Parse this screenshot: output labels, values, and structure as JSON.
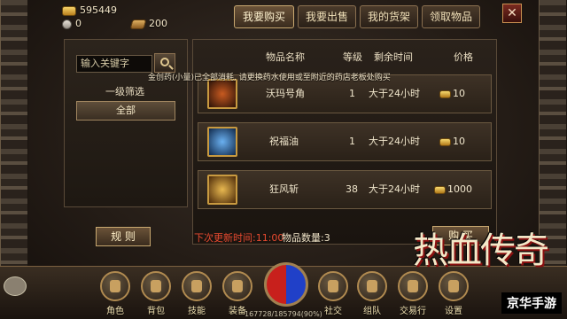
{
  "resources": {
    "gold": "595449",
    "silver": "0",
    "bars": "200"
  },
  "tabs": [
    {
      "label": "我要购买",
      "active": true
    },
    {
      "label": "我要出售",
      "active": false
    },
    {
      "label": "我的货架",
      "active": false
    },
    {
      "label": "领取物品",
      "active": false
    }
  ],
  "close_label": "✕",
  "search": {
    "placeholder": "输入关键字"
  },
  "filter": {
    "label": "一级筛选",
    "value": "全部"
  },
  "table": {
    "headers": [
      "物品名称",
      "等级",
      "剩余时间",
      "价格"
    ],
    "notice": "金创药(小量)已全部消耗, 请更换药水使用或至附近的药店老板处购买",
    "rows": [
      {
        "name": "沃玛号角",
        "level": "1",
        "time": "大于24小时",
        "price": "10",
        "icon_color": "#8a3a10"
      },
      {
        "name": "祝福油",
        "level": "1",
        "time": "大于24小时",
        "price": "10",
        "icon_color": "#2a6aa8"
      },
      {
        "name": "狂风斩",
        "level": "38",
        "time": "大于24小时",
        "price": "1000",
        "icon_color": "#a06a18"
      }
    ]
  },
  "status": {
    "refresh": "下次更新时间:11:00",
    "count": "物品数量:3"
  },
  "buttons": {
    "rules": "规 则",
    "buy": "购 买"
  },
  "nav": [
    "角色",
    "背包",
    "技能",
    "装备",
    "社交",
    "组队",
    "交易行",
    "设置"
  ],
  "hp_text": "167728/185794(90%)",
  "logo_text": "热血传奇",
  "watermark": "京华手游"
}
